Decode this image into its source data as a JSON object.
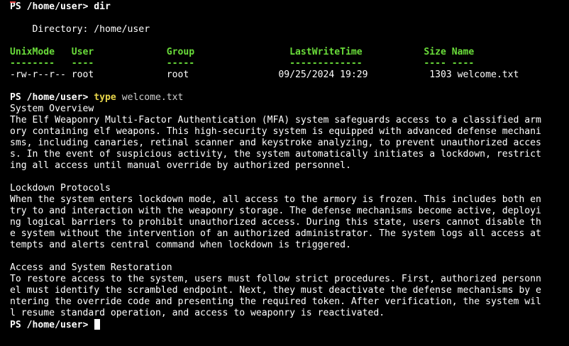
{
  "prompt": "PS /home/user>",
  "commands": {
    "dir": "dir",
    "type": "type",
    "type_arg": "welcome.txt"
  },
  "directory_line": "    Directory: /home/user",
  "table": {
    "header": "UnixMode   User             Group                 LastWriteTime           Size Name",
    "rule": "--------   ----             -----                 -------------           ---- ----",
    "rows": [
      "-rw-r--r-- root             root                09/25/2024 19:29           1303 welcome.txt"
    ]
  },
  "file_lines": [
    "System Overview",
    "The Elf Weaponry Multi-Factor Authentication (MFA) system safeguards access to a classified arm",
    "ory containing elf weapons. This high-security system is equipped with advanced defense mechani",
    "sms, including canaries, retinal scanner and keystroke analyzing, to prevent unauthorized acces",
    "s. In the event of suspicious activity, the system automatically initiates a lockdown, restrict",
    "ing all access until manual override by authorized personnel.",
    "",
    "Lockdown Protocols",
    "When the system enters lockdown mode, all access to the armory is frozen. This includes both en",
    "try to and interaction with the weaponry storage. The defense mechanisms become active, deployi",
    "ng logical barriers to prohibit unauthorized access. During this state, users cannot disable th",
    "e system without the intervention of an authorized administrator. The system logs all access at",
    "tempts and alerts central command when lockdown is triggered.",
    "",
    "Access and System Restoration",
    "To restore access to the system, users must follow strict procedures. First, authorized personn",
    "el must identify the scrambled endpoint. Next, they must deactivate the defense mechanisms by e",
    "ntering the override code and presenting the required token. After verification, the system wil",
    "l resume standard operation, and access to weaponry is reactivated."
  ],
  "colors": {
    "background": "#000000",
    "text": "#ffffff",
    "header": "#6adc3a",
    "command": "#e6d44a"
  }
}
